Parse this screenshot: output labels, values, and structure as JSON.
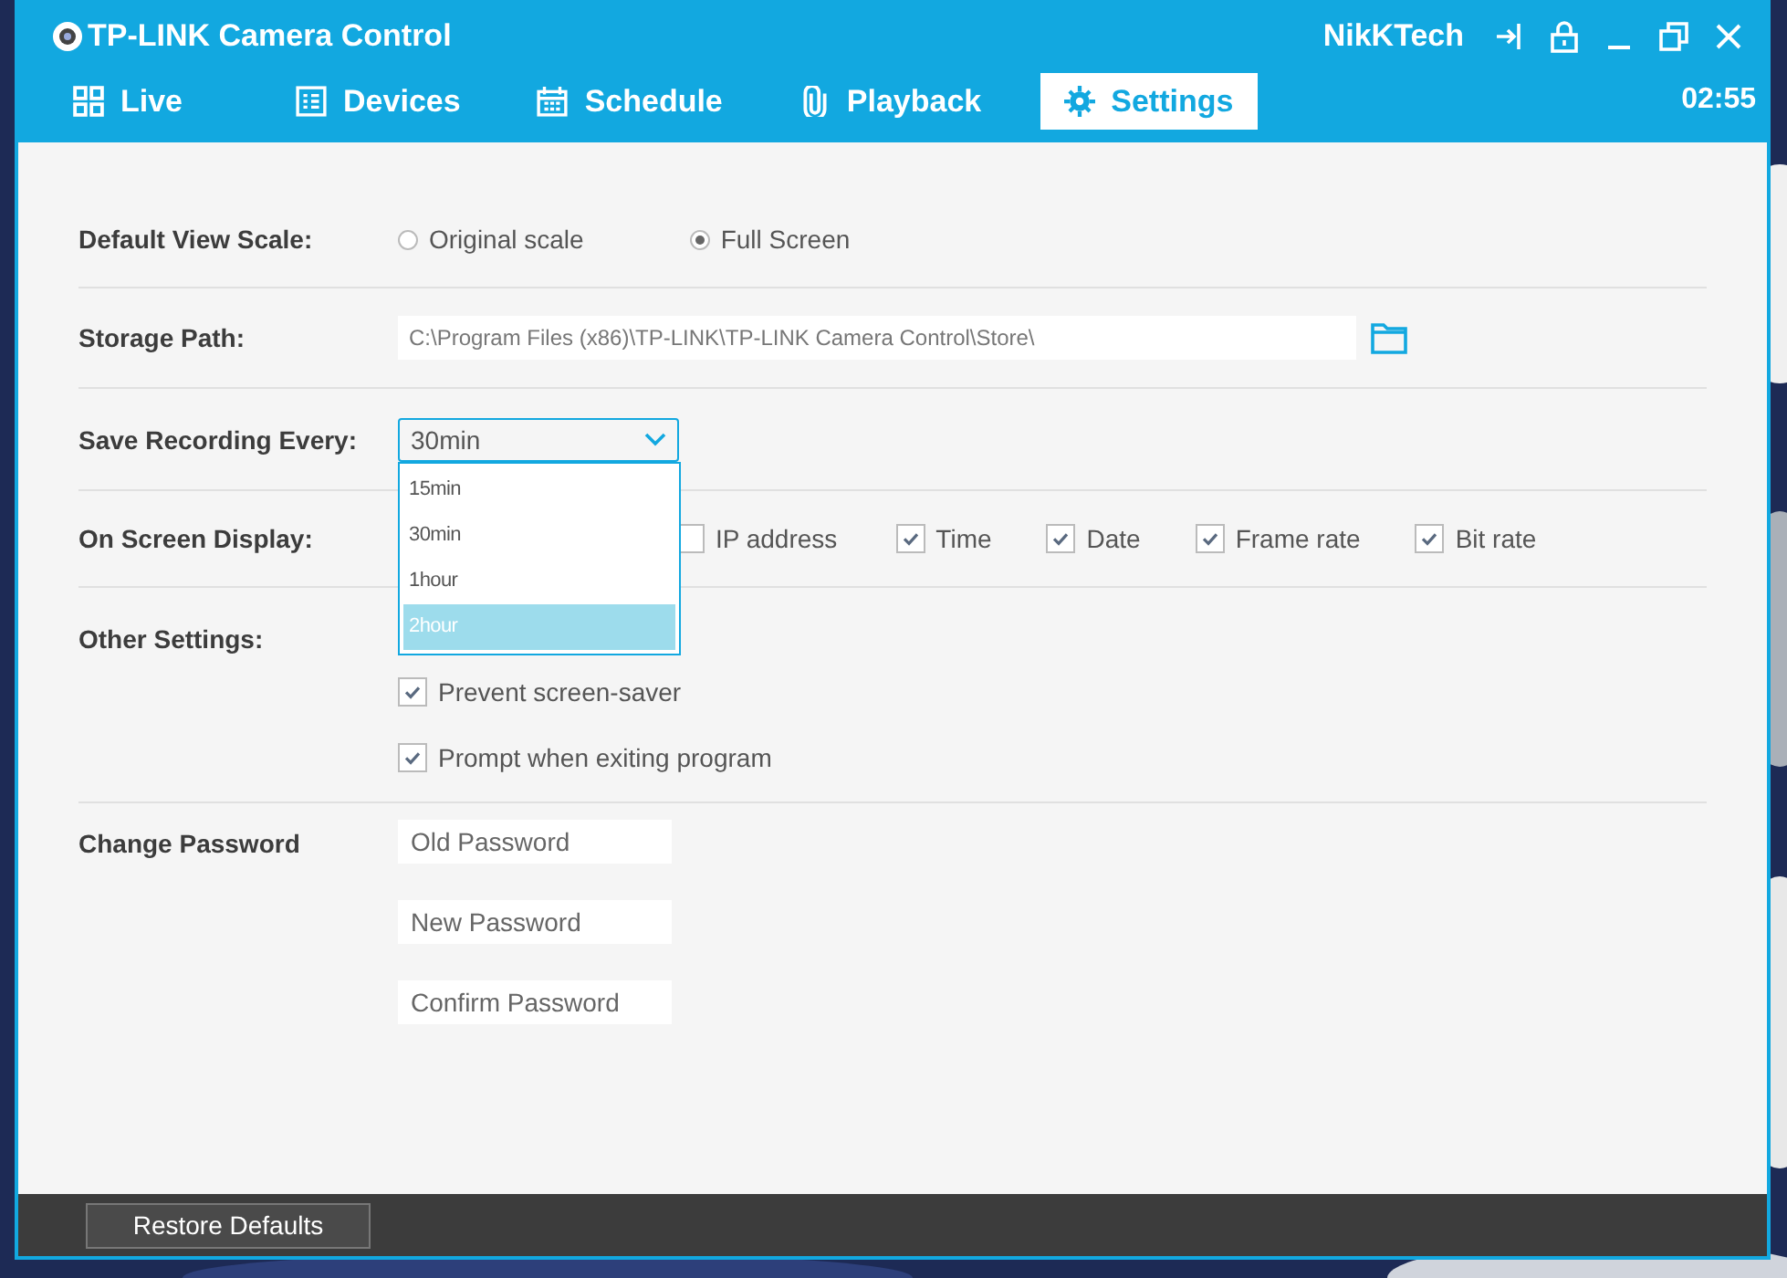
{
  "window": {
    "title": "TP-LINK Camera Control",
    "user": "NikKTech"
  },
  "tabs": [
    {
      "label": "Live",
      "selected": false
    },
    {
      "label": "Devices",
      "selected": false
    },
    {
      "label": "Schedule",
      "selected": false
    },
    {
      "label": "Playback",
      "selected": false
    },
    {
      "label": "Settings",
      "selected": true
    }
  ],
  "clock": "02:55",
  "view_scale": {
    "label": "Default View Scale:",
    "options": [
      {
        "label": "Original scale",
        "selected": false
      },
      {
        "label": "Full Screen",
        "selected": true
      }
    ]
  },
  "storage_path": {
    "label": "Storage Path:",
    "value": "C:\\Program Files (x86)\\TP-LINK\\TP-LINK Camera Control\\Store\\"
  },
  "save_recording": {
    "label": "Save Recording Every:",
    "value": "30min",
    "expanded": true,
    "options": [
      {
        "label": "15min",
        "highlighted": false
      },
      {
        "label": "30min",
        "highlighted": false
      },
      {
        "label": "1hour",
        "highlighted": false
      },
      {
        "label": "2hour",
        "highlighted": true
      }
    ]
  },
  "on_screen_display": {
    "label": "On Screen Display:",
    "items": [
      {
        "label": "IP address",
        "checked": false
      },
      {
        "label": "Time",
        "checked": true
      },
      {
        "label": "Date",
        "checked": true
      },
      {
        "label": "Frame rate",
        "checked": true
      },
      {
        "label": "Bit rate",
        "checked": true
      }
    ]
  },
  "other_settings": {
    "label": "Other Settings:",
    "items": [
      {
        "label": "Prevent screen-saver",
        "checked": true
      },
      {
        "label": "Prompt when exiting program",
        "checked": true
      }
    ]
  },
  "change_password": {
    "label": "Change Password",
    "fields": [
      {
        "placeholder": "Old Password"
      },
      {
        "placeholder": "New Password"
      },
      {
        "placeholder": "Confirm Password"
      }
    ]
  },
  "footer": {
    "button": "Restore Defaults"
  }
}
